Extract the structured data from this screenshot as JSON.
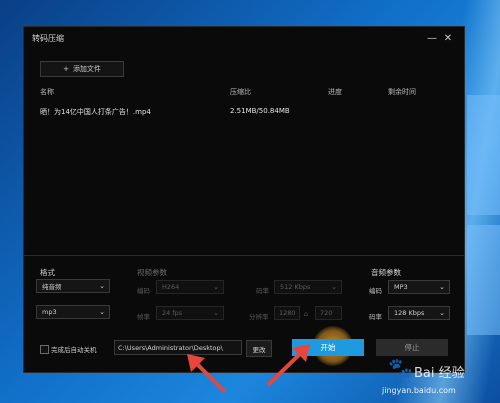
{
  "window": {
    "title": "转码压缩",
    "minimize": "—",
    "close": "✕"
  },
  "toolbar": {
    "add_file_icon": "+",
    "add_file_label": "添加文件"
  },
  "table": {
    "columns": [
      "名称",
      "压缩比",
      "进度",
      "剩余时间"
    ],
    "rows": [
      {
        "name": "晒！为14亿中国人打条广告！.mp4",
        "ratio": "2.51MB/50.84MB",
        "progress": "",
        "remaining": ""
      }
    ]
  },
  "format": {
    "label": "格式",
    "type_value": "纯音频",
    "container_value": "mp3"
  },
  "video": {
    "label": "视频参数",
    "codec_label": "编码",
    "codec_value": "H264",
    "fps_label": "帧率",
    "fps_value": "24 fps",
    "bitrate_label": "码率",
    "bitrate_value": "512 Kbps",
    "resolution_label": "分辨率",
    "width_value": "1280",
    "height_value": "720",
    "lock_icon": "lock-icon"
  },
  "audio": {
    "label": "音频参数",
    "codec_label": "编码",
    "codec_value": "MP3",
    "bitrate_label": "码率",
    "bitrate_value": "128 Kbps"
  },
  "footer": {
    "auto_shutdown_label": "完成后自动关机",
    "output_path": "C:\\Users\\Administrator\\Desktop\\",
    "change_label": "更改",
    "start_label": "开始",
    "stop_label": "停止"
  },
  "watermark": {
    "brand": "Bai 经验",
    "url": "jingyan.baidu.com"
  },
  "colors": {
    "accent": "#1e9be0",
    "window_bg": "#0a0a0a",
    "arrow": "#e8453c"
  }
}
